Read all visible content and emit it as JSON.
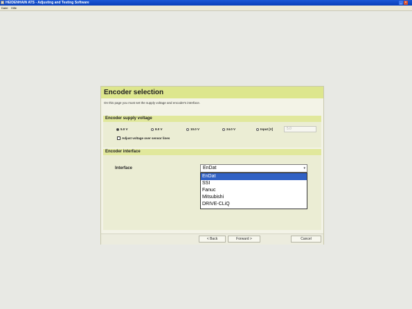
{
  "window": {
    "title": "HEIDENHAIN ATS - Adjusting and Testing Software",
    "minimize_glyph": "_",
    "close_glyph": "×"
  },
  "menu": {
    "items": [
      "Datei",
      "Hilfe"
    ]
  },
  "dialog": {
    "title": "Encoder selection",
    "description": "On this page you must set the supply voltage and encoder's interface.",
    "supply": {
      "heading": "Encoder supply voltage",
      "options": [
        {
          "label": "5.0 V",
          "selected": true
        },
        {
          "label": "8.0 V",
          "selected": false
        },
        {
          "label": "10.0 V",
          "selected": false
        },
        {
          "label": "24.0 V",
          "selected": false
        },
        {
          "label": "Input [V]",
          "selected": false
        }
      ],
      "input_value": "5.0",
      "checkbox_label": "Adjust voltage over sensor lines",
      "checkbox_checked": false
    },
    "interface": {
      "heading": "Encoder interface",
      "label": "Interface",
      "selected": "EnDat",
      "arrow": "▾",
      "options": [
        "EnDat",
        "SSI",
        "Fanuc",
        "Mitsubishi",
        "DRIVE-CLiQ"
      ]
    },
    "buttons": {
      "back": "< Back",
      "forward": "Forward >",
      "cancel": "Cancel"
    }
  }
}
